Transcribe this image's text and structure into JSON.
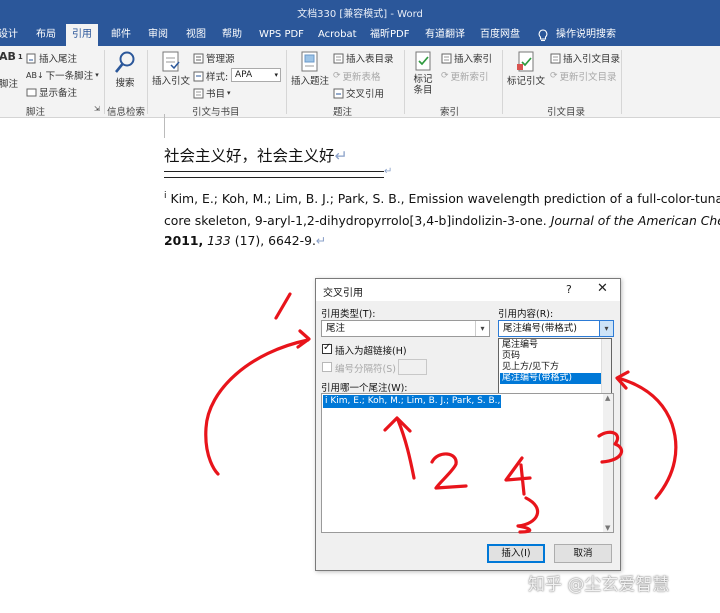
{
  "window": {
    "title": "文档330 [兼容模式] - Word"
  },
  "tabs": [
    "设计",
    "布局",
    "引用",
    "邮件",
    "审阅",
    "视图",
    "帮助",
    "WPS PDF",
    "Acrobat",
    "福昕PDF",
    "有道翻译",
    "百度网盘",
    "操作说明搜索"
  ],
  "active_tab": "引用",
  "ribbon": {
    "footnote_group": {
      "items": [
        "插入尾注",
        "下一条脚注",
        "显示备注"
      ],
      "left_label": "脚注",
      "label": "脚注"
    },
    "search_group": {
      "button": "搜索",
      "label": "信息检索"
    },
    "citation_group": {
      "insert_citation": "插入引文",
      "manage_sources": "管理源",
      "style_label": "样式:",
      "style_value": "APA",
      "bibliography": "书目",
      "label": "引文与书目"
    },
    "caption_group": {
      "insert_caption": "插入题注",
      "insert_table_of_figures": "插入表目录",
      "update_table": "更新表格",
      "cross_reference": "交叉引用",
      "label": "题注"
    },
    "index_group": {
      "mark_entry_line1": "标记",
      "mark_entry_line2": "条目",
      "insert_index": "插入索引",
      "update_index": "更新索引",
      "label": "索引"
    },
    "toa_group": {
      "mark_citation": "标记引文",
      "insert_toa": "插入引文目录",
      "update_toa": "更新引文目录",
      "label": "引文目录"
    }
  },
  "document": {
    "title_text": "社会主义好，社会主义好",
    "paragraph_mark": "↵",
    "reference": {
      "number": "i",
      "line1": "Kim, E.; Koh, M.; Lim, B. J.; Park, S. B., Emission wavelength prediction of a full-color-tunab",
      "line2": "core skeleton, 9-aryl-1,2-dihydropyrrolo[3,4-b]indolizin-3-one.",
      "journal": "Journal of the American Che",
      "year": "2011,",
      "volume": "133",
      "issue_pages": "(17), 6642-9."
    }
  },
  "dialog": {
    "title": "交叉引用",
    "help": "?",
    "close": "✕",
    "ref_type_label": "引用类型(T):",
    "ref_type_value": "尾注",
    "ref_content_label": "引用内容(R):",
    "ref_content_value": "尾注编号(带格式)",
    "dropdown_options": [
      "尾注编号",
      "页码",
      "见上方/见下方",
      "尾注编号(带格式)"
    ],
    "dropdown_selected_index": 3,
    "insert_hyperlink_label": "插入为超链接(H)",
    "insert_hyperlink_checked": true,
    "separator_label": "编号分隔符(S)",
    "which_label": "引用哪一个尾注(W):",
    "list_items": [
      "i  Kim, E.; Koh, M.; Lim, B. J.; Park, S. B., Emi"
    ],
    "insert_button": "插入(I)",
    "cancel_button": "取消"
  },
  "annotations": {
    "labels": [
      "1",
      "2",
      "3",
      "4"
    ],
    "color": "#e8141b"
  },
  "watermark": "知乎 @尘玄爱智慧",
  "colors": {
    "word_blue": "#2b579a",
    "selection": "#0078d7",
    "annotation_red": "#e8141b"
  }
}
